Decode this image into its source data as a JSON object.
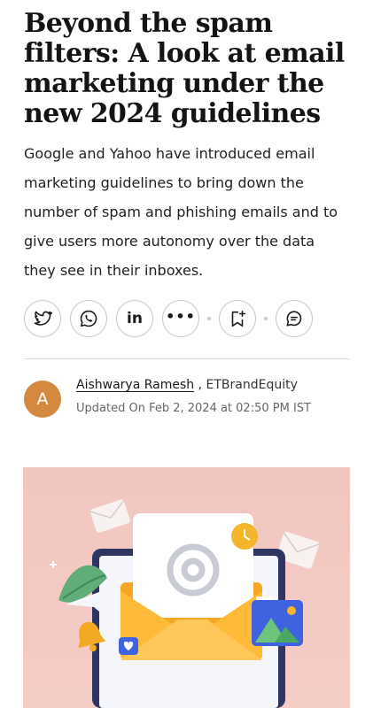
{
  "article": {
    "headline": "Beyond the spam filters: A look at email marketing under the new 2024 guidelines",
    "summary": "Google and Yahoo have introduced email marketing guidelines to bring down the number of spam and phishing emails and to give users more autonomy over the data they see in their inboxes."
  },
  "share": {
    "icons": [
      "twitter-icon",
      "whatsapp-icon",
      "linkedin-icon",
      "more-icon",
      "bookmark-add-icon",
      "comment-icon"
    ],
    "linkedin_label": "in",
    "more_label": "•••"
  },
  "author": {
    "initial": "A",
    "name": "Aishwarya Ramesh",
    "separator": " ,",
    "publication": "ETBrandEquity",
    "updated": "Updated On Feb 2, 2024 at 02:50 PM IST",
    "avatar_color": "#d4893f"
  },
  "hero_image": {
    "description_icon": "email-illustration",
    "background": "#f2c6c0"
  }
}
